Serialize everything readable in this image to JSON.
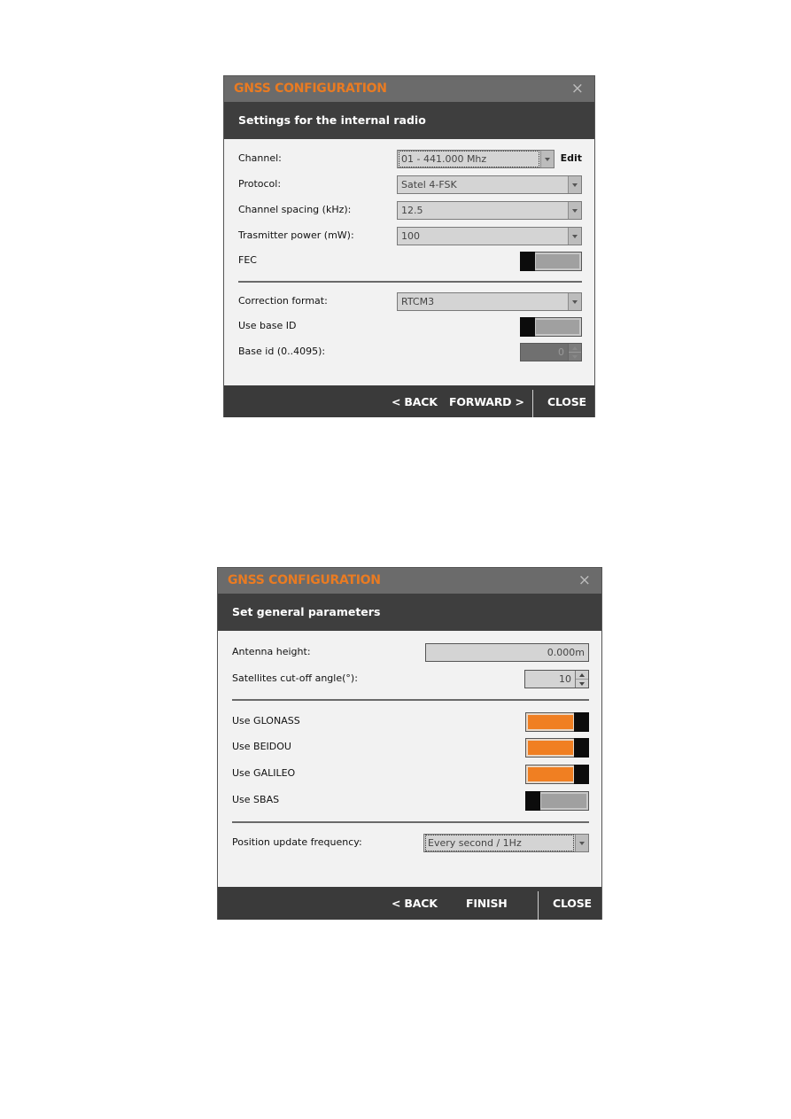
{
  "dialog1": {
    "title": "GNSS CONFIGURATION",
    "close_icon": "×",
    "subtitle": "Settings for the internal radio",
    "fields": {
      "channel": {
        "label": "Channel:",
        "value": "01 - 441.000 Mhz",
        "edit_label": "Edit"
      },
      "protocol": {
        "label": "Protocol:",
        "value": "Satel 4-FSK"
      },
      "channel_spacing": {
        "label": "Channel spacing (kHz):",
        "value": "12.5"
      },
      "transmitter_power": {
        "label": "Trasmitter power (mW):",
        "value": "100"
      },
      "fec": {
        "label": "FEC",
        "state": "off"
      },
      "correction_format": {
        "label": "Correction format:",
        "value": "RTCM3"
      },
      "use_base_id": {
        "label": "Use base ID",
        "state": "off"
      },
      "base_id": {
        "label": "Base id (0..4095):",
        "value": "0",
        "enabled": false
      }
    },
    "footer": {
      "back": "< BACK",
      "forward": "FORWARD >",
      "close": "CLOSE"
    }
  },
  "dialog2": {
    "title": "GNSS CONFIGURATION",
    "close_icon": "×",
    "subtitle": "Set general parameters",
    "fields": {
      "antenna_height": {
        "label": "Antenna height:",
        "value": "0.000m"
      },
      "cutoff_angle": {
        "label": "Satellites cut-off angle(°):",
        "value": "10"
      },
      "use_glonass": {
        "label": "Use GLONASS",
        "state": "on"
      },
      "use_beidou": {
        "label": "Use BEIDOU",
        "state": "on"
      },
      "use_galileo": {
        "label": "Use GALILEO",
        "state": "on"
      },
      "use_sbas": {
        "label": "Use SBAS",
        "state": "off"
      },
      "update_frequency": {
        "label": "Position update frequency:",
        "value": "Every second / 1Hz"
      }
    },
    "footer": {
      "back": "< BACK",
      "finish": "FINISH",
      "close": "CLOSE"
    }
  },
  "colors": {
    "accent": "#e97b22",
    "toggle_on": "#f07f22",
    "titlebar": "#6b6b6b",
    "header": "#3e3e3e",
    "footer": "#3a3a3a"
  }
}
